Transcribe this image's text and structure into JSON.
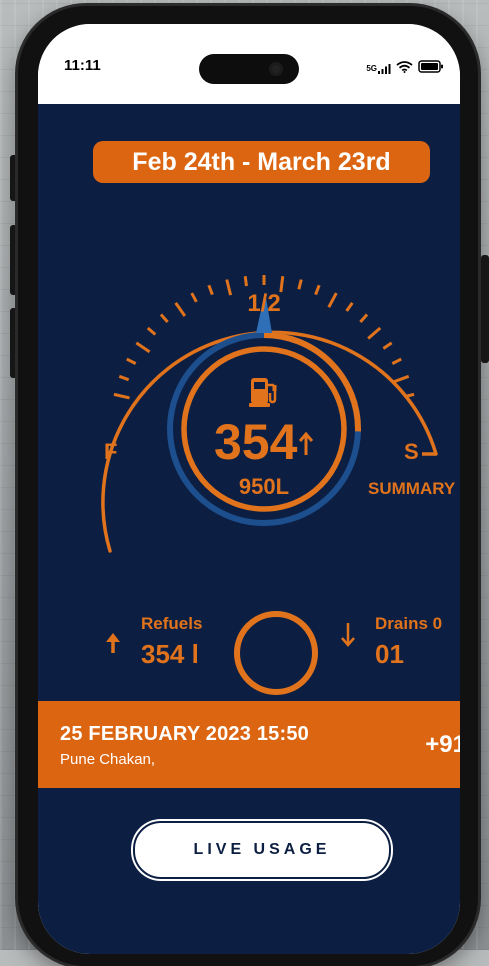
{
  "status_bar": {
    "time": "11:11",
    "network": "5G"
  },
  "date_range": "Feb 24th - March 23rd",
  "gauge": {
    "half_label": "1/2",
    "full_label": "F",
    "s_label": "S",
    "summary_label": "SUMMARY",
    "main_value": "354",
    "sub_value": "950L",
    "level_fraction": 0.5
  },
  "refuels": {
    "label": "Refuels",
    "value": "354 l"
  },
  "drains": {
    "label": "Drains 0",
    "value": "01"
  },
  "event": {
    "datetime": "25 FEBRUARY 2023 15:50",
    "location": "Pune Chakan,",
    "phone_fragment": "+91"
  },
  "live_button": "LIVE USAGE",
  "colors": {
    "accent": "#dc6512",
    "background": "#0c1f42",
    "ring_blue": "#1d4f8f"
  }
}
